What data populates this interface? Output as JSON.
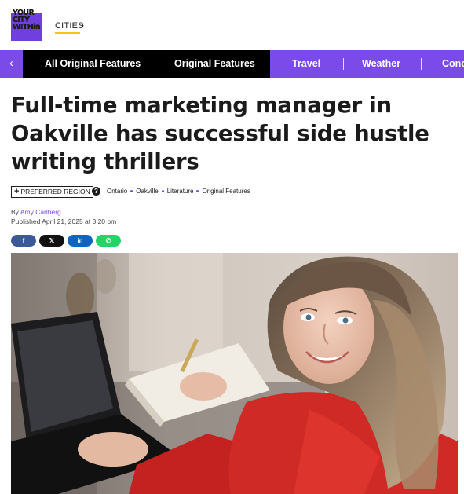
{
  "header": {
    "logo_lines": [
      "YOUR",
      "CITY",
      "WITHin"
    ],
    "cities_label": "CITIES",
    "cities_chevron": "›"
  },
  "nav": {
    "back_icon": "‹",
    "items": [
      "All Original Features",
      "Original Features",
      "Travel",
      "Weather",
      "Conc"
    ]
  },
  "article": {
    "title": "Full-time marketing manager in Oakville has successful side hustle writing thrillers",
    "region_badge": "PREFERRED REGION",
    "region_plus": "+",
    "help_icon": "?",
    "tags": [
      "Ontario",
      "Oakville",
      "Literature",
      "Original Features"
    ],
    "byline_prefix": "By",
    "author": "Amy Carlberg",
    "published": "Published April 21, 2025 at 3:20 pm"
  },
  "share": {
    "facebook": "f",
    "x": "𝕏",
    "linkedin": "in",
    "whatsapp": "✆"
  },
  "colors": {
    "accent": "#7b4bea",
    "nav_black": "#000000",
    "text": "#1b1b1b"
  }
}
